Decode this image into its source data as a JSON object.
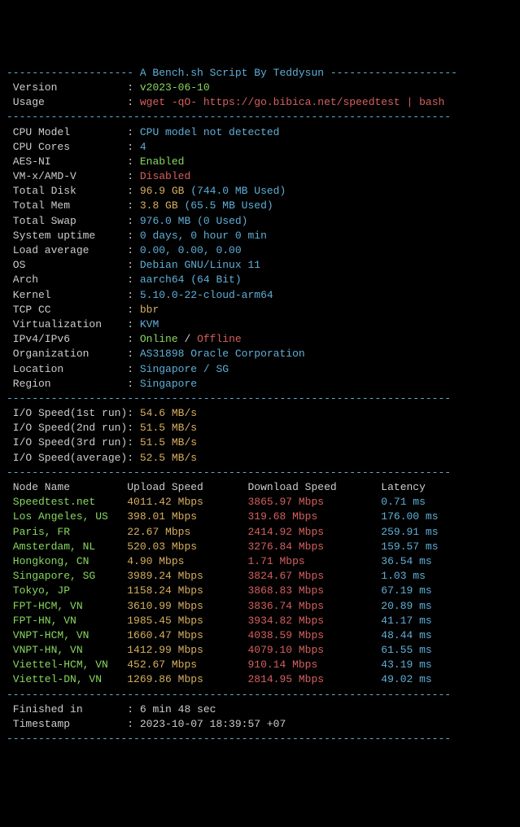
{
  "header": {
    "title": "A Bench.sh Script By Teddysun",
    "version_label": "Version",
    "version": "v2023-06-10",
    "usage_label": "Usage",
    "usage": "wget -qO- https://go.bibica.net/speedtest | bash"
  },
  "sysinfo": [
    {
      "label": "CPU Model",
      "value": "CPU model not detected",
      "color": "cyan"
    },
    {
      "label": "CPU Cores",
      "value": "4",
      "color": "cyan"
    },
    {
      "label": "AES-NI",
      "value": "Enabled",
      "color": "green"
    },
    {
      "label": "VM-x/AMD-V",
      "value": "Disabled",
      "color": "red"
    },
    {
      "label": "Total Disk",
      "value": "96.9 GB",
      "extra": "(744.0 MB Used)",
      "color": "yellow"
    },
    {
      "label": "Total Mem",
      "value": "3.8 GB",
      "extra": "(65.5 MB Used)",
      "color": "yellow"
    },
    {
      "label": "Total Swap",
      "value": "976.0 MB",
      "extra": "(0 Used)",
      "color": "cyan"
    },
    {
      "label": "System uptime",
      "value": "0 days, 0 hour 0 min",
      "color": "cyan"
    },
    {
      "label": "Load average",
      "value": "0.00, 0.00, 0.00",
      "color": "cyan"
    },
    {
      "label": "OS",
      "value": "Debian GNU/Linux 11",
      "color": "cyan"
    },
    {
      "label": "Arch",
      "value": "aarch64 (64 Bit)",
      "color": "cyan"
    },
    {
      "label": "Kernel",
      "value": "5.10.0-22-cloud-arm64",
      "color": "cyan"
    },
    {
      "label": "TCP CC",
      "value": "bbr",
      "color": "yellow"
    },
    {
      "label": "Virtualization",
      "value": "KVM",
      "color": "cyan"
    }
  ],
  "network": {
    "label": "IPv4/IPv6",
    "online": "Online",
    "offline": "Offline",
    "sep": " / "
  },
  "org": {
    "label": "Organization",
    "value": "AS31898 Oracle Corporation"
  },
  "loc": {
    "label": "Location",
    "value": "Singapore / SG"
  },
  "region": {
    "label": "Region",
    "value": "Singapore"
  },
  "io": [
    {
      "label": "I/O Speed(1st run)",
      "value": "54.6 MB/s"
    },
    {
      "label": "I/O Speed(2nd run)",
      "value": "51.5 MB/s"
    },
    {
      "label": "I/O Speed(3rd run)",
      "value": "51.5 MB/s"
    },
    {
      "label": "I/O Speed(average)",
      "value": "52.5 MB/s"
    }
  ],
  "speed_header": {
    "node": "Node Name",
    "up": "Upload Speed",
    "down": "Download Speed",
    "lat": "Latency"
  },
  "speed": [
    {
      "node": "Speedtest.net",
      "up": "4011.42 Mbps",
      "down": "3865.97 Mbps",
      "lat": "0.71 ms"
    },
    {
      "node": "Los Angeles, US",
      "up": "398.01 Mbps",
      "down": "319.68 Mbps",
      "lat": "176.00 ms"
    },
    {
      "node": "Paris, FR",
      "up": "22.67 Mbps",
      "down": "2414.92 Mbps",
      "lat": "259.91 ms"
    },
    {
      "node": "Amsterdam, NL",
      "up": "520.03 Mbps",
      "down": "3276.84 Mbps",
      "lat": "159.57 ms"
    },
    {
      "node": "Hongkong, CN",
      "up": "4.90 Mbps",
      "down": "1.71 Mbps",
      "lat": "36.54 ms"
    },
    {
      "node": "Singapore, SG",
      "up": "3989.24 Mbps",
      "down": "3824.67 Mbps",
      "lat": "1.03 ms"
    },
    {
      "node": "Tokyo, JP",
      "up": "1158.24 Mbps",
      "down": "3868.83 Mbps",
      "lat": "67.19 ms"
    },
    {
      "node": "FPT-HCM, VN",
      "up": "3610.99 Mbps",
      "down": "3836.74 Mbps",
      "lat": "20.89 ms"
    },
    {
      "node": "FPT-HN, VN",
      "up": "1985.45 Mbps",
      "down": "3934.82 Mbps",
      "lat": "41.17 ms"
    },
    {
      "node": "VNPT-HCM, VN",
      "up": "1660.47 Mbps",
      "down": "4038.59 Mbps",
      "lat": "48.44 ms"
    },
    {
      "node": "VNPT-HN, VN",
      "up": "1412.99 Mbps",
      "down": "4079.10 Mbps",
      "lat": "61.55 ms"
    },
    {
      "node": "Viettel-HCM, VN",
      "up": "452.67 Mbps",
      "down": "910.14 Mbps",
      "lat": "43.19 ms"
    },
    {
      "node": "Viettel-DN, VN",
      "up": "1269.86 Mbps",
      "down": "2814.95 Mbps",
      "lat": "49.02 ms"
    }
  ],
  "footer": {
    "finished_label": "Finished in",
    "finished": "6 min 48 sec",
    "ts_label": "Timestamp",
    "ts": "2023-10-07 18:39:57 +07"
  },
  "chart_data": {
    "type": "table",
    "title": "A Bench.sh Script By Teddysun — Speedtest results",
    "columns": [
      "Node Name",
      "Upload Speed (Mbps)",
      "Download Speed (Mbps)",
      "Latency (ms)"
    ],
    "rows": [
      [
        "Speedtest.net",
        4011.42,
        3865.97,
        0.71
      ],
      [
        "Los Angeles, US",
        398.01,
        319.68,
        176.0
      ],
      [
        "Paris, FR",
        22.67,
        2414.92,
        259.91
      ],
      [
        "Amsterdam, NL",
        520.03,
        3276.84,
        159.57
      ],
      [
        "Hongkong, CN",
        4.9,
        1.71,
        36.54
      ],
      [
        "Singapore, SG",
        3989.24,
        3824.67,
        1.03
      ],
      [
        "Tokyo, JP",
        1158.24,
        3868.83,
        67.19
      ],
      [
        "FPT-HCM, VN",
        3610.99,
        3836.74,
        20.89
      ],
      [
        "FPT-HN, VN",
        1985.45,
        3934.82,
        41.17
      ],
      [
        "VNPT-HCM, VN",
        1660.47,
        4038.59,
        48.44
      ],
      [
        "VNPT-HN, VN",
        1412.99,
        4079.1,
        61.55
      ],
      [
        "Viettel-HCM, VN",
        452.67,
        910.14,
        43.19
      ],
      [
        "Viettel-DN, VN",
        1269.86,
        2814.95,
        49.02
      ]
    ],
    "io_speed_MBps": {
      "run1": 54.6,
      "run2": 51.5,
      "run3": 51.5,
      "average": 52.5
    }
  }
}
